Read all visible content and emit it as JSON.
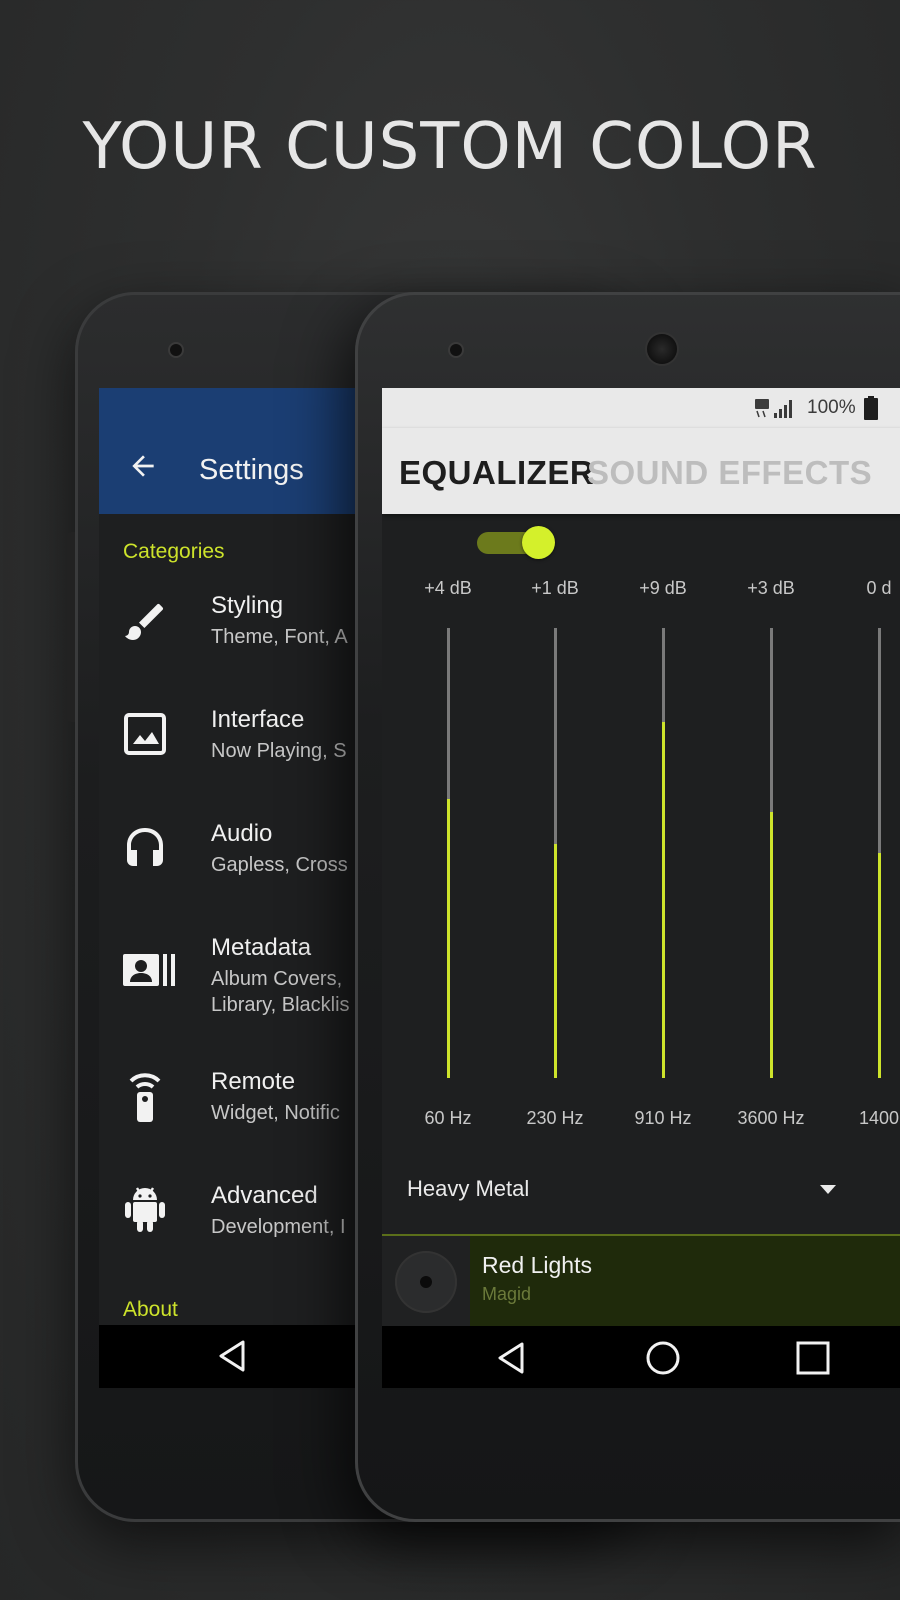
{
  "headline": "YOUR CUSTOM COLOR",
  "colors": {
    "accent": "#cde32b",
    "appbar_blue": "#1b3e73"
  },
  "settings_screen": {
    "title": "Settings",
    "section_categories": "Categories",
    "section_about": "About",
    "items": [
      {
        "icon": "brush-icon",
        "title": "Styling",
        "subtitle": "Theme, Font, A"
      },
      {
        "icon": "image-icon",
        "title": "Interface",
        "subtitle": "Now Playing, S"
      },
      {
        "icon": "headphones-icon",
        "title": "Audio",
        "subtitle": "Gapless, Cross"
      },
      {
        "icon": "id-card-icon",
        "title": "Metadata",
        "subtitle": "Album Covers,",
        "subtitle2": "Library, Blacklis"
      },
      {
        "icon": "remote-icon",
        "title": "Remote",
        "subtitle": "Widget, Notific"
      },
      {
        "icon": "android-icon",
        "title": "Advanced",
        "subtitle": "Development, I"
      }
    ]
  },
  "equalizer_screen": {
    "status_text": "100%",
    "tab_equalizer": "EQUALIZER",
    "tab_sound_effects": "SOUND EFFECTS",
    "enabled": true,
    "bands": [
      {
        "gain": "+4 dB",
        "freq": "60 Hz",
        "level": 0.62
      },
      {
        "gain": "+1 dB",
        "freq": "230 Hz",
        "level": 0.52
      },
      {
        "gain": "+9 dB",
        "freq": "910 Hz",
        "level": 0.79
      },
      {
        "gain": "+3 dB",
        "freq": "3600 Hz",
        "level": 0.59
      },
      {
        "gain": "0 d",
        "freq": "1400",
        "level": 0.5
      }
    ],
    "preset": "Heavy Metal",
    "now_playing": {
      "title": "Red Lights",
      "artist": "Magid"
    }
  }
}
